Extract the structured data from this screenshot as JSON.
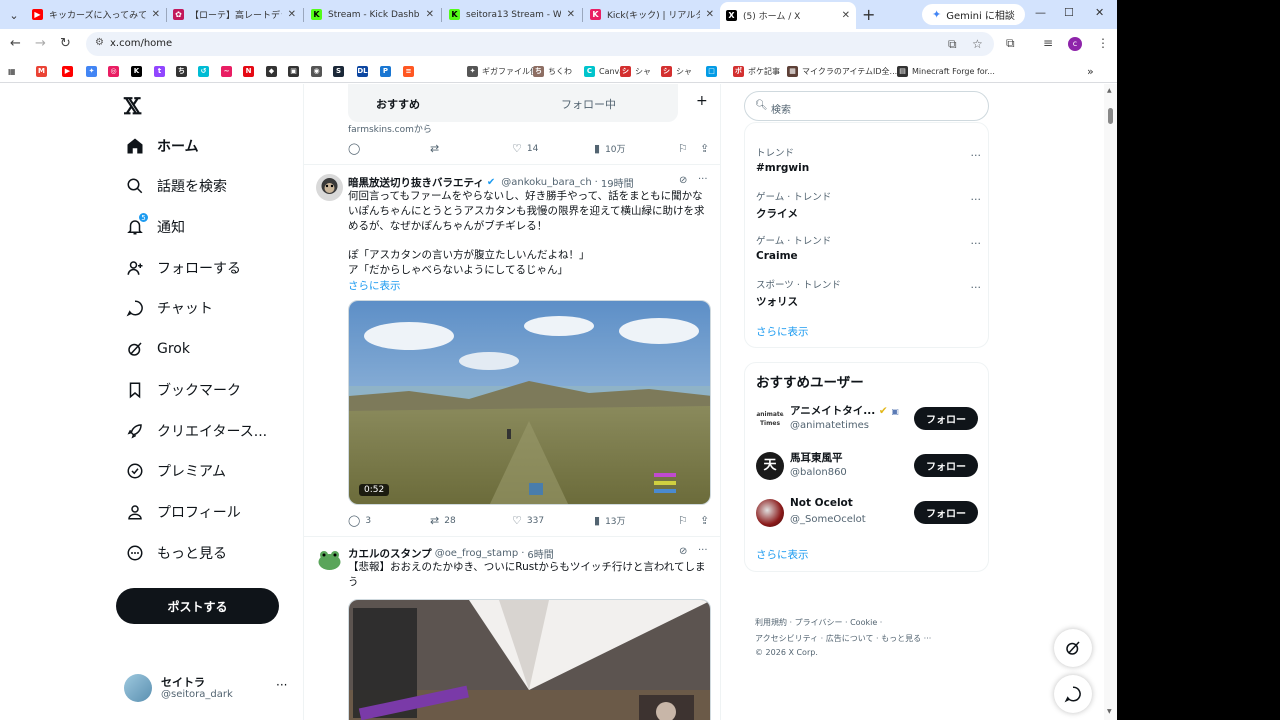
{
  "tabs": [
    {
      "title": "キッカーズに入ってみて - You",
      "fav_color": "#ff0000",
      "fav": "▶"
    },
    {
      "title": "【ローテ】高レートデッキリスト",
      "fav_color": "#c2185b",
      "fav": "✿"
    },
    {
      "title": "Stream - Kick Dashboard",
      "fav_color": "#53fc18",
      "fav": "K"
    },
    {
      "title": "seitora13 Stream - Watch",
      "fav_color": "#53fc18",
      "fav": "K"
    },
    {
      "title": "Kick(キック) | リアルタイムラ",
      "fav_color": "#e91e63",
      "fav": "K"
    },
    {
      "title": "(5) ホーム / X",
      "fav_color": "#000000",
      "fav": "X"
    }
  ],
  "gemini_label": "Gemini に相談",
  "url": "x.com/home",
  "bookmarks": [
    {
      "label": "",
      "color": "#ea4335",
      "fav": "M"
    },
    {
      "label": "",
      "color": "#ff0000",
      "fav": "▶"
    },
    {
      "label": "",
      "color": "#4285f4",
      "fav": "✦"
    },
    {
      "label": "",
      "color": "#e91e63",
      "fav": "◎"
    },
    {
      "label": "",
      "color": "#000000",
      "fav": "K"
    },
    {
      "label": "",
      "color": "#9146ff",
      "fav": "t"
    },
    {
      "label": "",
      "color": "#333333",
      "fav": "ち"
    },
    {
      "label": "",
      "color": "#00bcd4",
      "fav": "↺"
    },
    {
      "label": "",
      "color": "#e91e63",
      "fav": "~"
    },
    {
      "label": "",
      "color": "#e50914",
      "fav": "N"
    },
    {
      "label": "",
      "color": "#333333",
      "fav": "◆"
    },
    {
      "label": "",
      "color": "#333333",
      "fav": "▣"
    },
    {
      "label": "",
      "color": "#555555",
      "fav": "◉"
    },
    {
      "label": "",
      "color": "#1b2838",
      "fav": "S"
    },
    {
      "label": "",
      "color": "#0d47a1",
      "fav": "DL"
    },
    {
      "label": "",
      "color": "#1976d2",
      "fav": "P"
    },
    {
      "label": "",
      "color": "#ff5722",
      "fav": "≡"
    },
    {
      "label": "ギガファイル便",
      "color": "#555555",
      "fav": "✦"
    },
    {
      "label": "ちくわ",
      "color": "#8d6e63",
      "fav": "ち"
    },
    {
      "label": "Canva",
      "color": "#00c4cc",
      "fav": "C"
    },
    {
      "label": "シャ",
      "color": "#d32f2f",
      "fav": "シ"
    },
    {
      "label": "シャ",
      "color": "#d32f2f",
      "fav": "シ"
    },
    {
      "label": "",
      "color": "#039be5",
      "fav": "□"
    },
    {
      "label": "ポケ記事",
      "color": "#d32f2f",
      "fav": "ポ"
    },
    {
      "label": "マイクラのアイテムID全...",
      "color": "#5d4037",
      "fav": "▦"
    },
    {
      "label": "Minecraft Forge for...",
      "color": "#333333",
      "fav": "▤"
    }
  ],
  "nav": {
    "home": "ホーム",
    "explore": "話題を検索",
    "notifications": "通知",
    "notif_count": "5",
    "follow": "フォローする",
    "chat": "チャット",
    "grok": "Grok",
    "bookmarks": "ブックマーク",
    "creator": "クリエイタース...",
    "premium": "プレミアム",
    "profile": "プロフィール",
    "more": "もっと見る",
    "post": "ポストする"
  },
  "account": {
    "name": "セイトラ",
    "handle": "@seitora_dark"
  },
  "timeline": {
    "tab_recommended": "おすすめ",
    "tab_following": "フォロー中",
    "source_line": "farmskins.comから",
    "prev_actions": {
      "likes": "14",
      "views": "10万"
    },
    "tweet1": {
      "name": "暗黒放送切り抜きバラエティ",
      "handle": "@ankoku_bara_ch",
      "time": "19時間",
      "line1": "何回言ってもファームをやらないし、好き勝手やって、話をまともに聞かな",
      "line2": "いぽんちゃんにとうとうアスカタンも我慢の限界を迎えて横山緑に助けを求",
      "line3": "めるが、なぜかぽんちゃんがブチギレる！",
      "line4": "ぽ「アスカタンの言い方が腹立たしいんだよね！」",
      "line5": "ア「だからしゃべらないようにしてるじゃん」",
      "show_more": "さらに表示",
      "video_time": "0:52",
      "replies": "3",
      "reposts": "28",
      "likes": "337",
      "views": "13万"
    },
    "tweet2": {
      "name": "カエルのスタンプ",
      "handle": "@oe_frog_stamp",
      "time": "6時間",
      "line1": "【悲報】おおえのたかゆき、ついにRustからもツイッチ行けと言われてしま",
      "line2": "う"
    }
  },
  "right": {
    "search_placeholder": "検索",
    "trends": [
      {
        "category": "トレンド",
        "name": "#mrgwin"
      },
      {
        "category": "ゲーム · トレンド",
        "name": "クライメ"
      },
      {
        "category": "ゲーム · トレンド",
        "name": "Craime"
      },
      {
        "category": "スポーツ · トレンド",
        "name": "ツォリス"
      }
    ],
    "trends_more": "さらに表示",
    "who_title": "おすすめユーザー",
    "users": [
      {
        "name": "アニメイトタイ...",
        "handle": "@animatetimes",
        "avatar_text": "animate Times",
        "follow": "フォロー"
      },
      {
        "name": "馬耳東風平",
        "handle": "@balon860",
        "avatar_text": "天",
        "follow": "フォロー"
      },
      {
        "name": "Not Ocelot",
        "handle": "@_SomeOcelot",
        "avatar_text": "",
        "follow": "フォロー"
      }
    ],
    "users_more": "さらに表示",
    "footer_line1": "利用規約 ·  プライバシー ·  Cookie ·",
    "footer_line2": "アクセシビリティ ·  広告について ·  もっと見る ···",
    "footer_line3": "© 2026 X Corp."
  }
}
